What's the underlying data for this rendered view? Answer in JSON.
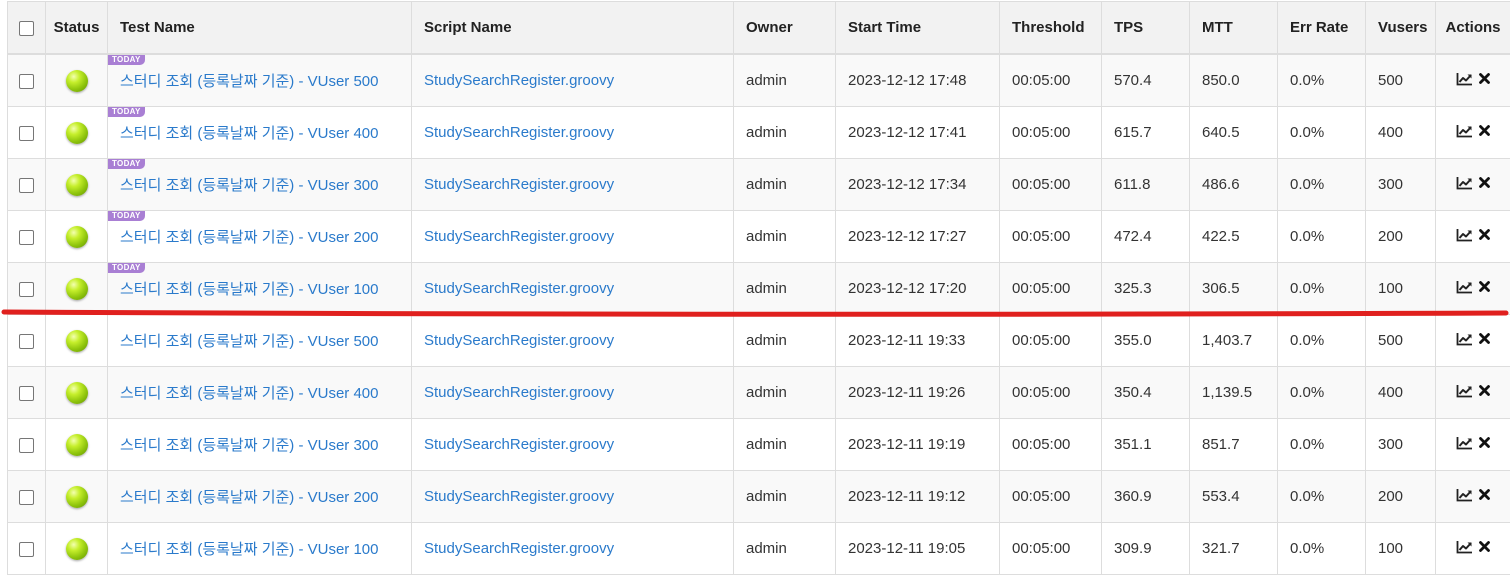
{
  "headers": {
    "status": "Status",
    "test_name": "Test Name",
    "script_name": "Script Name",
    "owner": "Owner",
    "start_time": "Start Time",
    "threshold": "Threshold",
    "tps": "TPS",
    "mtt": "MTT",
    "err_rate": "Err Rate",
    "vusers": "Vusers",
    "actions": "Actions"
  },
  "today_badge": "TODAY",
  "colors": {
    "status": "green",
    "separator": "#e0201e",
    "link": "#2a7acb",
    "badge": "#a97fd4"
  },
  "icons": {
    "chart": "line-chart-icon",
    "delete": "close-icon"
  },
  "rows": [
    {
      "today": true,
      "name": "스터디 조회 (등록날짜 기준) - VUser 500",
      "script": "StudySearchRegister.groovy",
      "owner": "admin",
      "start": "2023-12-12 17:48",
      "threshold": "00:05:00",
      "tps": "570.4",
      "mtt": "850.0",
      "err": "0.0%",
      "vusers": "500"
    },
    {
      "today": true,
      "name": "스터디 조회 (등록날짜 기준) - VUser 400",
      "script": "StudySearchRegister.groovy",
      "owner": "admin",
      "start": "2023-12-12 17:41",
      "threshold": "00:05:00",
      "tps": "615.7",
      "mtt": "640.5",
      "err": "0.0%",
      "vusers": "400"
    },
    {
      "today": true,
      "name": "스터디 조회 (등록날짜 기준) - VUser 300",
      "script": "StudySearchRegister.groovy",
      "owner": "admin",
      "start": "2023-12-12 17:34",
      "threshold": "00:05:00",
      "tps": "611.8",
      "mtt": "486.6",
      "err": "0.0%",
      "vusers": "300"
    },
    {
      "today": true,
      "name": "스터디 조회 (등록날짜 기준) - VUser 200",
      "script": "StudySearchRegister.groovy",
      "owner": "admin",
      "start": "2023-12-12 17:27",
      "threshold": "00:05:00",
      "tps": "472.4",
      "mtt": "422.5",
      "err": "0.0%",
      "vusers": "200"
    },
    {
      "today": true,
      "name": "스터디 조회 (등록날짜 기준) - VUser 100",
      "script": "StudySearchRegister.groovy",
      "owner": "admin",
      "start": "2023-12-12 17:20",
      "threshold": "00:05:00",
      "tps": "325.3",
      "mtt": "306.5",
      "err": "0.0%",
      "vusers": "100"
    },
    {
      "today": false,
      "name": "스터디 조회 (등록날짜 기준) - VUser 500",
      "script": "StudySearchRegister.groovy",
      "owner": "admin",
      "start": "2023-12-11 19:33",
      "threshold": "00:05:00",
      "tps": "355.0",
      "mtt": "1,403.7",
      "err": "0.0%",
      "vusers": "500"
    },
    {
      "today": false,
      "name": "스터디 조회 (등록날짜 기준) - VUser 400",
      "script": "StudySearchRegister.groovy",
      "owner": "admin",
      "start": "2023-12-11 19:26",
      "threshold": "00:05:00",
      "tps": "350.4",
      "mtt": "1,139.5",
      "err": "0.0%",
      "vusers": "400"
    },
    {
      "today": false,
      "name": "스터디 조회 (등록날짜 기준) - VUser 300",
      "script": "StudySearchRegister.groovy",
      "owner": "admin",
      "start": "2023-12-11 19:19",
      "threshold": "00:05:00",
      "tps": "351.1",
      "mtt": "851.7",
      "err": "0.0%",
      "vusers": "300"
    },
    {
      "today": false,
      "name": "스터디 조회 (등록날짜 기준) - VUser 200",
      "script": "StudySearchRegister.groovy",
      "owner": "admin",
      "start": "2023-12-11 19:12",
      "threshold": "00:05:00",
      "tps": "360.9",
      "mtt": "553.4",
      "err": "0.0%",
      "vusers": "200"
    },
    {
      "today": false,
      "name": "스터디 조회 (등록날짜 기준) - VUser 100",
      "script": "StudySearchRegister.groovy",
      "owner": "admin",
      "start": "2023-12-11 19:05",
      "threshold": "00:05:00",
      "tps": "309.9",
      "mtt": "321.7",
      "err": "0.0%",
      "vusers": "100"
    }
  ]
}
